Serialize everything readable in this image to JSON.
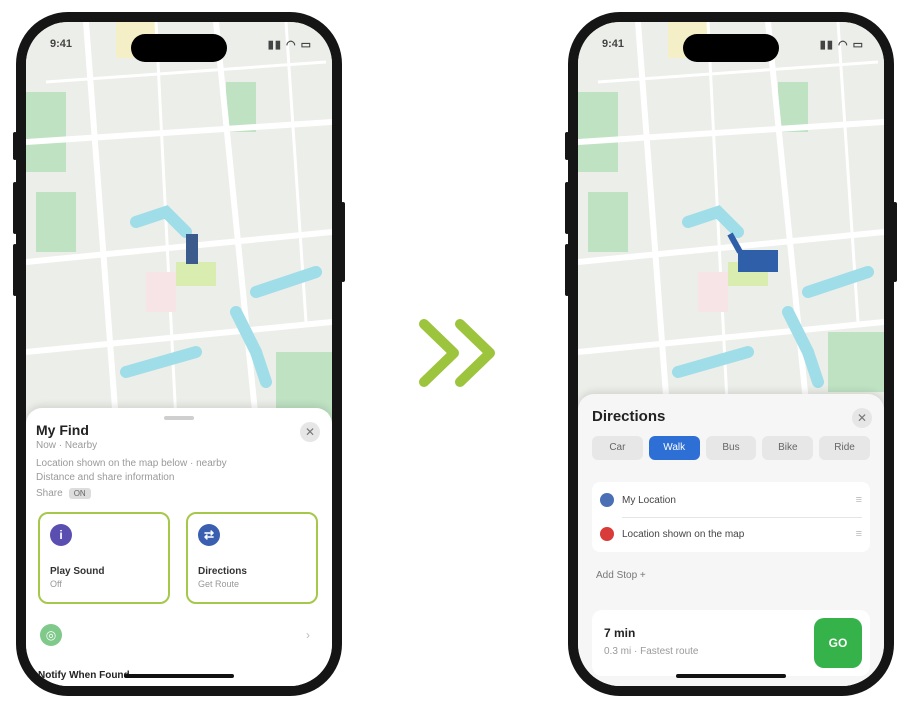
{
  "colors": {
    "highlight": "#a6c84a",
    "arrow": "#9cc43d",
    "route_blue": "#2e6fd6",
    "go_green": "#35b24a",
    "card_icon_purple": "#5a4fb0",
    "card_icon_blue": "#3a5fb0",
    "destination_red": "#d93a3a"
  },
  "left_phone": {
    "status": {
      "time": "9:41",
      "icons": "▮▮ ◠ ▭"
    },
    "sheet": {
      "title": "My Find",
      "subtitle": "Now · Nearby",
      "address_1": "Location shown on the map below · nearby",
      "address_2": "Distance and share information",
      "share_label": "Share",
      "share_badge": "ON",
      "close": "✕",
      "cards": [
        {
          "icon": "i",
          "title": "Play Sound",
          "sub": "Off"
        },
        {
          "icon": "⇄",
          "title": "Directions",
          "sub": "Get Route"
        }
      ],
      "bottom_title": "Notify When Found",
      "bottom_icon": "◎"
    }
  },
  "middle": {
    "icon": "double-chevron-right"
  },
  "right_phone": {
    "status": {
      "time": "9:41",
      "icons": "▮▮ ◠ ▭"
    },
    "sheet": {
      "title": "Directions",
      "close": "✕",
      "modes": [
        "Car",
        "Walk",
        "Bus",
        "Bike",
        "Ride"
      ],
      "active_mode": 1,
      "from": "My Location",
      "to": "Location shown on the map",
      "add_stop": "Add Stop +",
      "trip_title": "7 min",
      "trip_sub": "0.3 mi · Fastest route",
      "go_label": "GO"
    }
  }
}
